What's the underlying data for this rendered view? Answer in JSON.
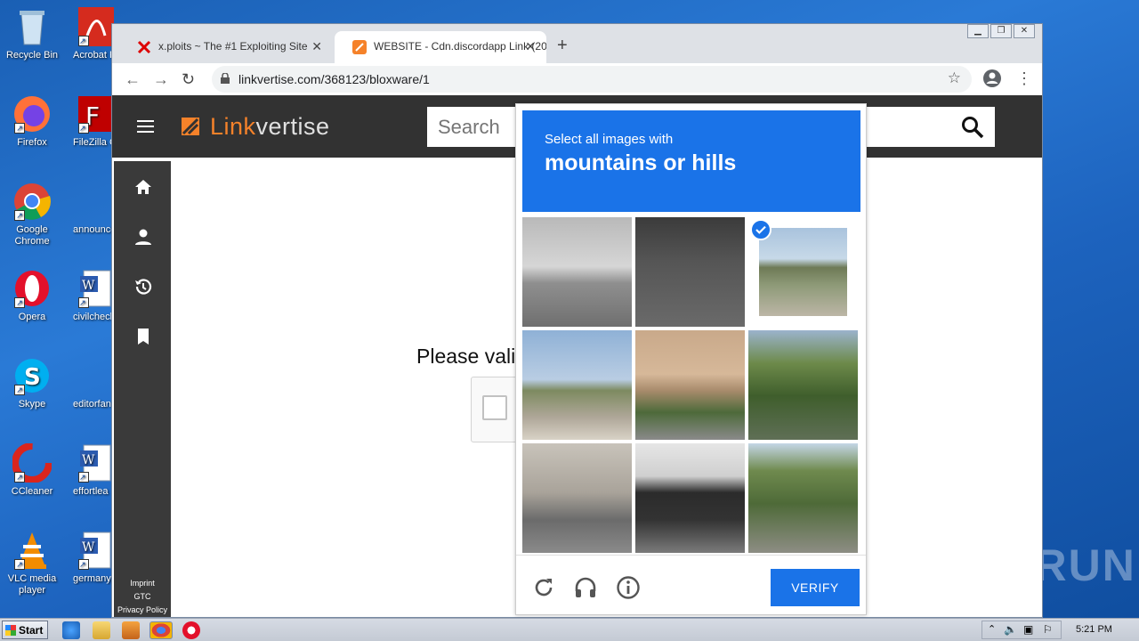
{
  "desktop": {
    "icons": [
      {
        "label": "Recycle Bin"
      },
      {
        "label": "Acrobat Reader"
      },
      {
        "label": "Firefox"
      },
      {
        "label": "FileZilla Client"
      },
      {
        "label": "Google Chrome"
      },
      {
        "label": "announce"
      },
      {
        "label": "Opera"
      },
      {
        "label": "civilcheck"
      },
      {
        "label": "Skype"
      },
      {
        "label": "editorfan"
      },
      {
        "label": "CCleaner"
      },
      {
        "label": "effortlea"
      },
      {
        "label": "VLC media player"
      },
      {
        "label": "germanys"
      }
    ],
    "watermark": "ANY RUN"
  },
  "browser": {
    "tabs": [
      {
        "title": "x.ploits ~ The #1 Exploiting Site",
        "close": "✕"
      },
      {
        "title": "WEBSITE - Cdn.discordapp Link (202",
        "close": "✕"
      }
    ],
    "new_tab": "+",
    "url": "linkvertise.com/368123/bloxware/1"
  },
  "page": {
    "logo_prefix": "Link",
    "logo_suffix": "vertise",
    "search_placeholder": "Search",
    "sidebar_links": [
      "Imprint",
      "GTC",
      "Privacy Policy"
    ],
    "validate_text": "Please vali"
  },
  "captcha": {
    "instruction": "Select all images with",
    "target": "mountains or hills",
    "verify_label": "VERIFY",
    "selected_tiles": [
      2
    ],
    "accent_color": "#1a73e8"
  },
  "taskbar": {
    "start_label": "Start",
    "clock": "5:21 PM"
  }
}
